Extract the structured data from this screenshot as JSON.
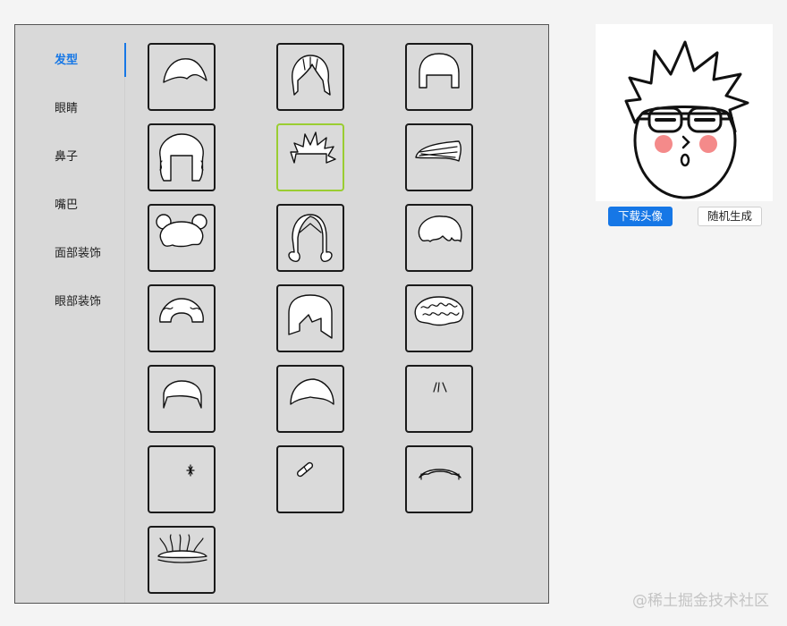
{
  "sidebar": {
    "items": [
      {
        "label": "发型",
        "active": true
      },
      {
        "label": "眼睛",
        "active": false
      },
      {
        "label": "鼻子",
        "active": false
      },
      {
        "label": "嘴巴",
        "active": false
      },
      {
        "label": "面部装饰",
        "active": false
      },
      {
        "label": "眼部装饰",
        "active": false
      }
    ]
  },
  "hair_grid": {
    "selected_index": 4,
    "tiles": [
      {
        "icon": "hair-wavy-bang-icon"
      },
      {
        "icon": "hair-shaggy-long-icon"
      },
      {
        "icon": "hair-bowl-cut-icon"
      },
      {
        "icon": "hair-curly-long-icon"
      },
      {
        "icon": "hair-spiky-icon"
      },
      {
        "icon": "hair-side-swept-icon"
      },
      {
        "icon": "hair-pigtail-buns-icon"
      },
      {
        "icon": "hair-long-curled-icon"
      },
      {
        "icon": "hair-messy-short-icon"
      },
      {
        "icon": "hair-bob-curly-icon"
      },
      {
        "icon": "hair-straight-bob-icon"
      },
      {
        "icon": "hair-afro-curls-icon"
      },
      {
        "icon": "hair-short-cap-icon"
      },
      {
        "icon": "hair-flat-bang-icon"
      },
      {
        "icon": "hair-few-strands-icon"
      },
      {
        "icon": "hair-tiny-tuft-icon"
      },
      {
        "icon": "hair-bandage-icon"
      },
      {
        "icon": "hair-balding-icon"
      },
      {
        "icon": "hair-dreads-icon"
      }
    ]
  },
  "preview": {
    "avatar_icon": "avatar-preview-icon",
    "cheek_color": "#f48a8a"
  },
  "actions": {
    "download_label": "下载头像",
    "random_label": "随机生成"
  },
  "watermark": "@稀土掘金技术社区",
  "colors": {
    "accent": "#1677e6",
    "selected_border": "#9acd32"
  }
}
